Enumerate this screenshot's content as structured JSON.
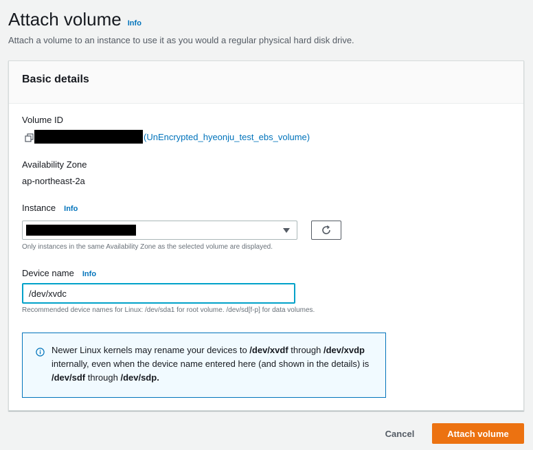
{
  "header": {
    "title": "Attach volume",
    "info": "Info",
    "subtitle": "Attach a volume to an instance to use it as you would a regular physical hard disk drive."
  },
  "card": {
    "title": "Basic details"
  },
  "volume": {
    "label": "Volume ID",
    "link": "(UnEncrypted_hyeonju_test_ebs_volume)",
    "copy_icon": "copy-icon"
  },
  "availability_zone": {
    "label": "Availability Zone",
    "value": "ap-northeast-2a"
  },
  "instance": {
    "label": "Instance",
    "info": "Info",
    "hint": "Only instances in the same Availability Zone as the selected volume are displayed.",
    "caret_icon": "caret-down-icon",
    "refresh_icon": "refresh-icon"
  },
  "device": {
    "label": "Device name",
    "info": "Info",
    "value": "/dev/xvdc",
    "hint": "Recommended device names for Linux: /dev/sda1 for root volume. /dev/sd[f-p] for data volumes."
  },
  "alert": {
    "icon": "info-circle-icon",
    "t1": "Newer Linux kernels may rename your devices to ",
    "b1": "/dev/xvdf",
    "t2": " through ",
    "b2": "/dev/xvdp",
    "t3": " internally, even when the device name entered here (and shown in the details) is ",
    "b3": "/dev/sdf",
    "t4": " through ",
    "b4": "/dev/sdp."
  },
  "footer": {
    "cancel": "Cancel",
    "attach": "Attach volume"
  },
  "colors": {
    "primary": "#ec7211",
    "link": "#0073bb",
    "alert_border": "#0073bb",
    "alert_bg": "#f1faff",
    "focus": "#00a1c9"
  }
}
